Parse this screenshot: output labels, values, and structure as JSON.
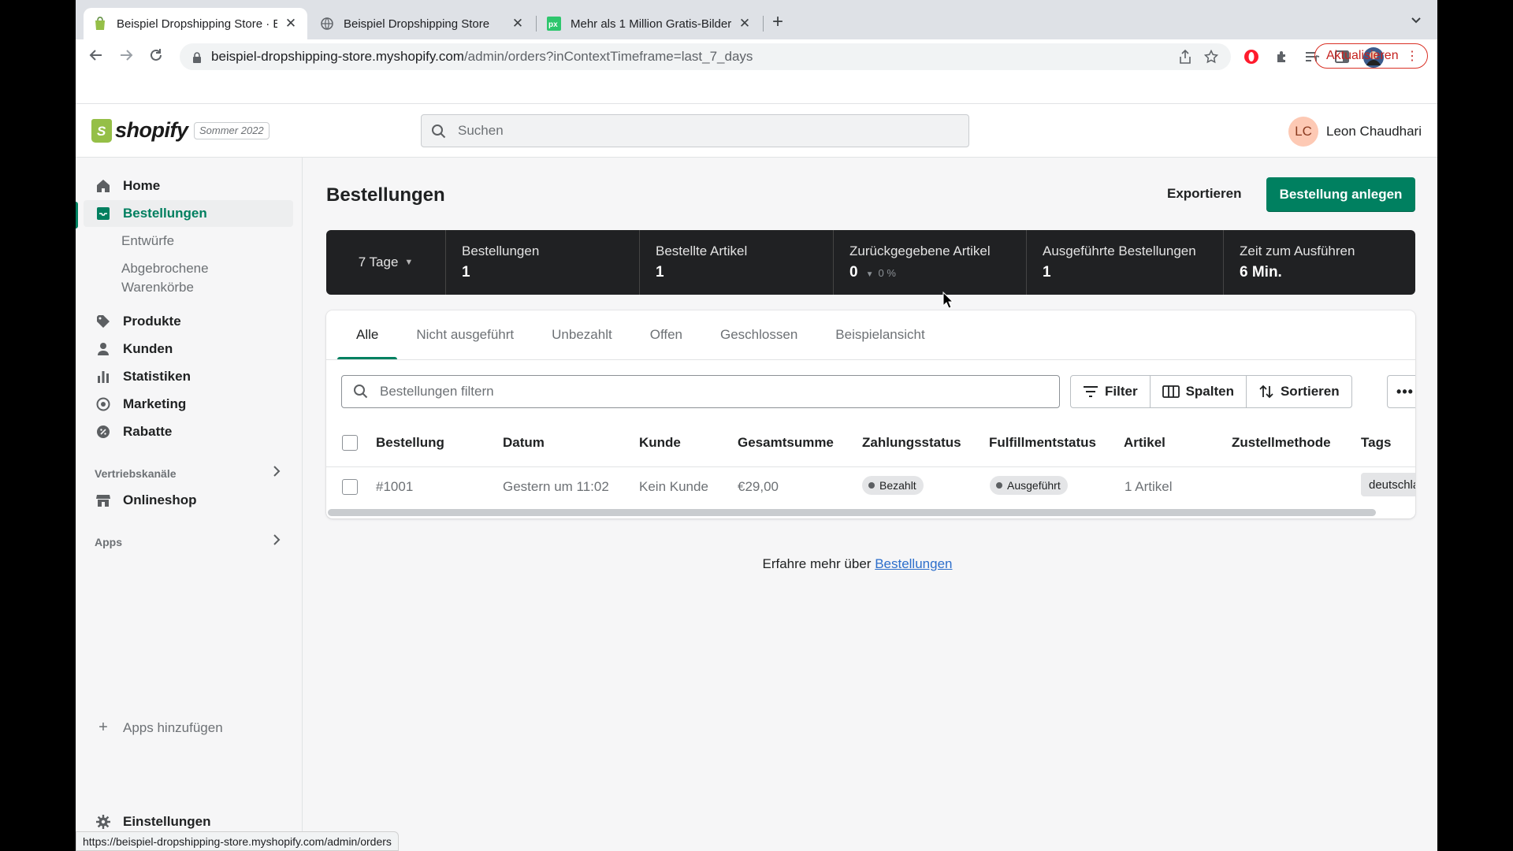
{
  "browser": {
    "tabs": [
      {
        "title": "Beispiel Dropshipping Store · E",
        "active": true,
        "favicon": "shopify-icon"
      },
      {
        "title": "Beispiel Dropshipping Store",
        "active": false,
        "favicon": "globe-icon"
      },
      {
        "title": "Mehr als 1 Million Gratis-Bilder",
        "active": false,
        "favicon": "pixabay-icon"
      }
    ],
    "url_domain": "beispiel-dropshipping-store.myshopify.com",
    "url_path": "/admin/orders?inContextTimeframe=last_7_days",
    "update_label": "Aktualisieren",
    "status_url": "https://beispiel-dropshipping-store.myshopify.com/admin/orders"
  },
  "topbar": {
    "logo_text": "shopify",
    "edition": "Sommer 2022",
    "search_placeholder": "Suchen",
    "user_initials": "LC",
    "user_name": "Leon Chaudhari"
  },
  "sidebar": {
    "items": [
      {
        "label": "Home",
        "icon": "home-icon"
      },
      {
        "label": "Bestellungen",
        "icon": "orders-icon",
        "active": true
      },
      {
        "label": "Produkte",
        "icon": "tag-icon"
      },
      {
        "label": "Kunden",
        "icon": "person-icon"
      },
      {
        "label": "Statistiken",
        "icon": "bar-chart-icon"
      },
      {
        "label": "Marketing",
        "icon": "target-icon"
      },
      {
        "label": "Rabatte",
        "icon": "discount-icon"
      }
    ],
    "sub_items": [
      "Entwürfe",
      "Abgebrochene",
      "Warenkörbe"
    ],
    "sales_channels_label": "Vertriebskanäle",
    "onlineshop_label": "Onlineshop",
    "apps_label": "Apps",
    "add_apps_label": "Apps hinzufügen",
    "settings_label": "Einstellungen"
  },
  "main": {
    "title": "Bestellungen",
    "export_label": "Exportieren",
    "create_label": "Bestellung anlegen",
    "period": "7 Tage",
    "stats": [
      {
        "label": "Bestellungen",
        "value": "1"
      },
      {
        "label": "Bestellte Artikel",
        "value": "1"
      },
      {
        "label": "Zurückgegebene Artikel",
        "value": "0",
        "sub": "0 %"
      },
      {
        "label": "Ausgeführte Bestellungen",
        "value": "1"
      },
      {
        "label": "Zeit zum Ausführen",
        "value": "6 Min."
      }
    ],
    "tabs": [
      "Alle",
      "Nicht ausgeführt",
      "Unbezahlt",
      "Offen",
      "Geschlossen",
      "Beispielansicht"
    ],
    "filter_placeholder": "Bestellungen filtern",
    "filter_label": "Filter",
    "columns_label": "Spalten",
    "sort_label": "Sortieren",
    "headers": [
      "Bestellung",
      "Datum",
      "Kunde",
      "Gesamtsumme",
      "Zahlungsstatus",
      "Fulfillmentstatus",
      "Artikel",
      "Zustellmethode",
      "Tags"
    ],
    "rows": [
      {
        "order": "#1001",
        "date": "Gestern um 11:02",
        "customer": "Kein Kunde",
        "total": "€29,00",
        "payment": "Bezahlt",
        "fulfillment": "Ausgeführt",
        "items": "1 Artikel",
        "delivery": "",
        "tags": "deutschland"
      }
    ],
    "learn_more_prefix": "Erfahre mehr über ",
    "learn_more_link": "Bestellungen"
  },
  "colors": {
    "accent": "#008060",
    "stats_bg": "#202123",
    "link": "#2c6ecb"
  }
}
